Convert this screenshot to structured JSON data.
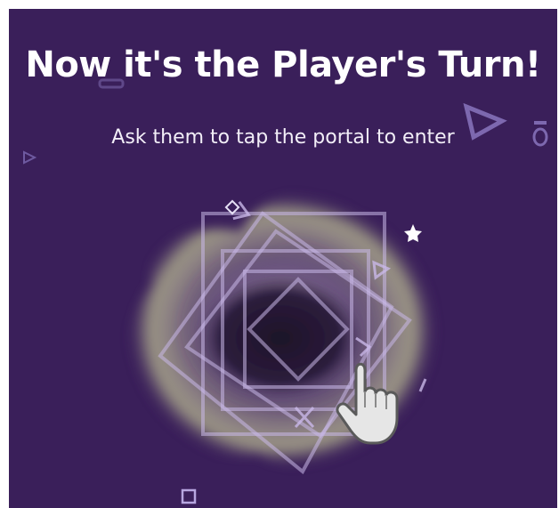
{
  "screen": {
    "title": "Now it's the Player's Turn!",
    "subtitle": "Ask them to tap the portal to enter"
  },
  "portal": {
    "icon": "portal-icon",
    "hand_icon": "tap-hand-icon"
  },
  "colors": {
    "background": "#3a1f5a",
    "title": "#ffffff",
    "shape_outline": "#c9b8e8",
    "hand": "#e6e6e6"
  }
}
